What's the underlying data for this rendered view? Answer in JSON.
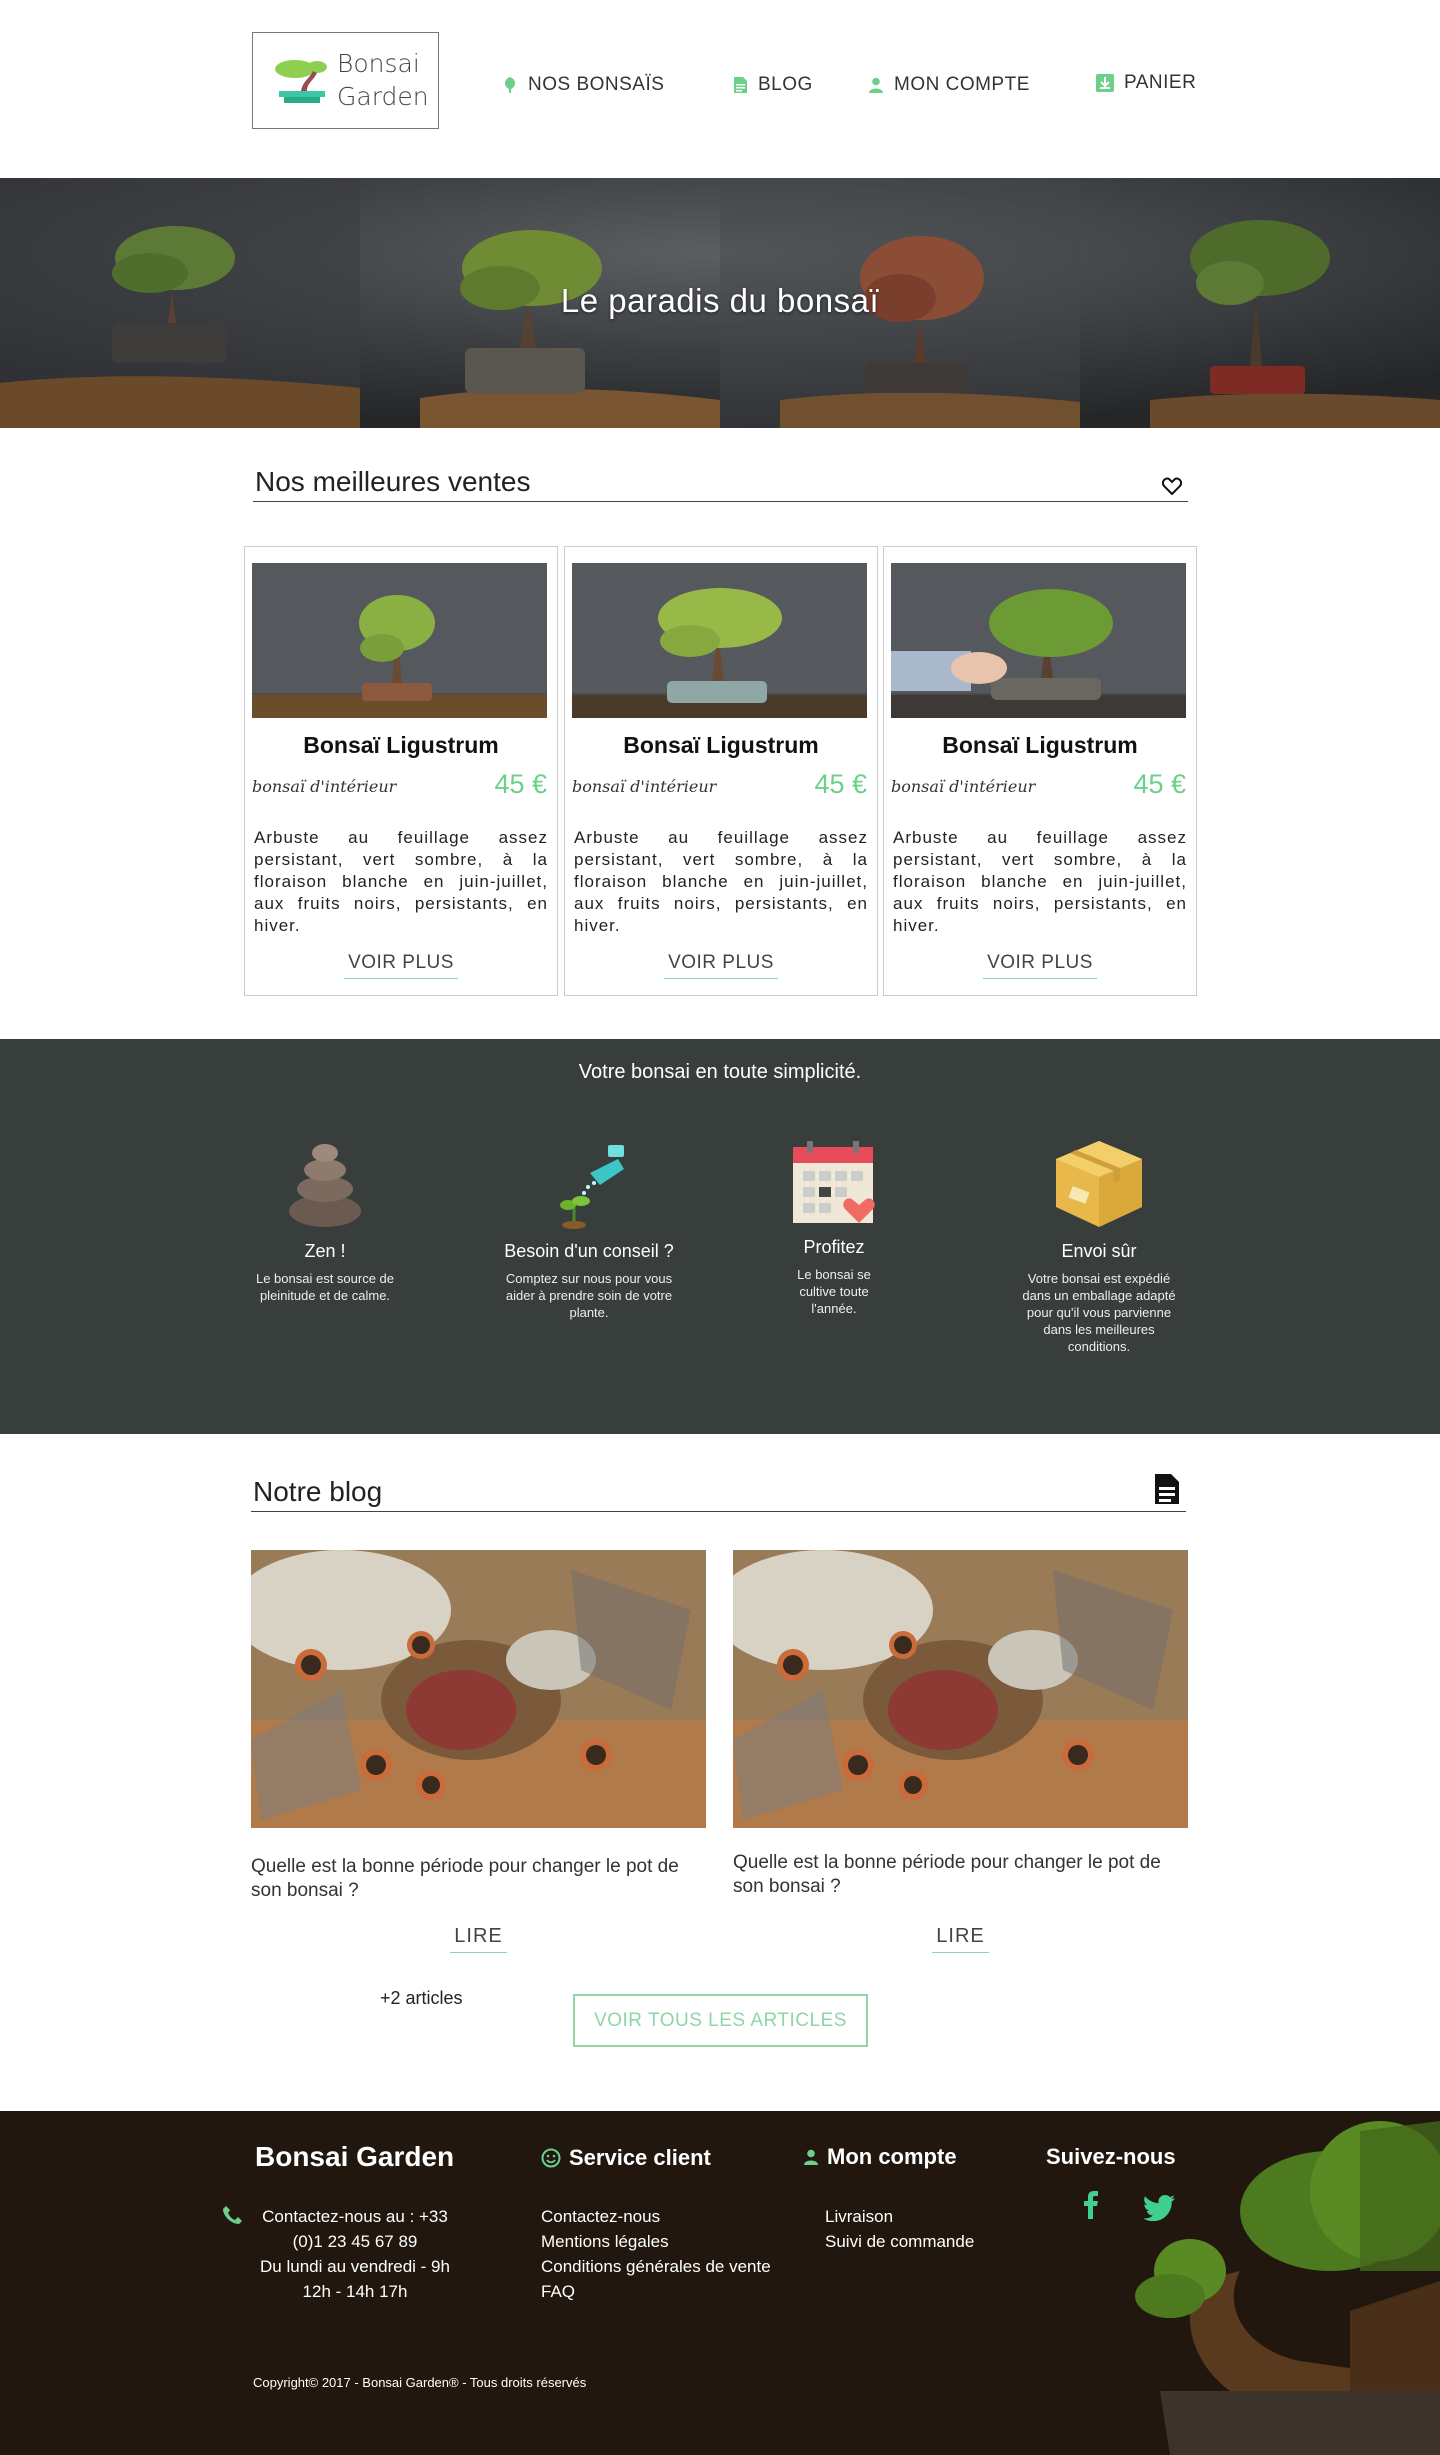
{
  "brand": {
    "logo_line1": "Bonsai",
    "logo_line2": "Garden"
  },
  "nav": {
    "bonsais": "NOS BONSAÏS",
    "blog": "BLOG",
    "account": "MON COMPTE",
    "cart": "PANIER"
  },
  "hero": {
    "title": "Le paradis du bonsaï"
  },
  "bestsellers": {
    "title": "Nos meilleures ventes",
    "products": [
      {
        "name": "Bonsaï Ligustrum",
        "category": "bonsaï d'intérieur",
        "price": "45 €",
        "description": "Arbuste au feuillage assez persistant, vert sombre, à la floraison blanche en juin-juillet, aux fruits noirs, persistants, en hiver.",
        "cta": "VOIR PLUS"
      },
      {
        "name": "Bonsaï Ligustrum",
        "category": "bonsaï d'intérieur",
        "price": "45 €",
        "description": "Arbuste au feuillage assez persistant, vert sombre, à la floraison blanche en juin-juillet, aux fruits noirs, persistants, en hiver.",
        "cta": "VOIR PLUS"
      },
      {
        "name": "Bonsaï Ligustrum",
        "category": "bonsaï d'intérieur",
        "price": "45 €",
        "description": "Arbuste au feuillage assez persistant, vert sombre, à la floraison blanche en juin-juillet, aux fruits noirs, persistants, en hiver.",
        "cta": "VOIR PLUS"
      }
    ]
  },
  "features": {
    "heading": "Votre bonsai en toute simplicité.",
    "items": [
      {
        "title": "Zen !",
        "text": "Le bonsai est source de pleinitude et de calme.",
        "icon": "zen-stones-icon"
      },
      {
        "title": "Besoin d'un conseil ?",
        "text": "Comptez sur nous pour vous aider à prendre soin de votre plante.",
        "icon": "watering-can-icon"
      },
      {
        "title": "Profitez",
        "text": "Le bonsai se cultive toute l'année.",
        "icon": "calendar-heart-icon"
      },
      {
        "title": "Envoi sûr",
        "text": "Votre bonsai est expédié dans un emballage adapté pour qu'il vous parvienne dans les meilleures conditions.",
        "icon": "package-box-icon"
      }
    ]
  },
  "blog": {
    "title": "Notre blog",
    "posts": [
      {
        "question": "Quelle est la bonne période pour changer le pot de son bonsai ?",
        "cta": "LIRE"
      },
      {
        "question": "Quelle est la bonne période pour changer le pot de son bonsai ?",
        "cta": "LIRE"
      }
    ],
    "more_count": "+2 articles",
    "all_button": "VOIR TOUS LES ARTICLES"
  },
  "footer": {
    "brand": "Bonsai Garden",
    "contact_line1": "Contactez-nous au : +33",
    "contact_line2": "(0)1 23 45 67 89",
    "contact_line3": "Du lundi au vendredi - 9h",
    "contact_line4": "12h - 14h 17h",
    "service_title": "Service client",
    "service_links": [
      "Contactez-nous",
      "Mentions légales",
      "Conditions générales de vente",
      "FAQ"
    ],
    "account_title": "Mon compte",
    "account_links": [
      "Livraison",
      "Suivi de commande"
    ],
    "social_title": "Suivez-nous",
    "copyright": "Copyright© 2017 - Bonsai Garden® - Tous droits réservés"
  },
  "colors": {
    "accent": "#6cd08a",
    "dark_band": "#383e3b",
    "footer_bg": "#22170e"
  }
}
